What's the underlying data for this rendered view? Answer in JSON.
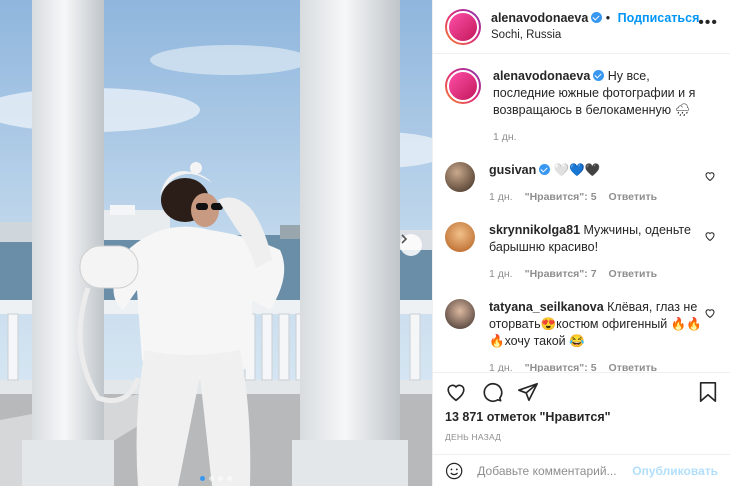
{
  "post": {
    "username": "alenavodonaeva",
    "follow_label": "Подписаться",
    "location": "Sochi, Russia",
    "more_icon": "more-horizontal-icon",
    "colors": {
      "link": "#0095f6",
      "verified": "#3897f0",
      "muted": "#8e8e8e"
    },
    "carousel": {
      "total_slides": 4,
      "active_slide": 1
    },
    "caption": {
      "username": "alenavodonaeva",
      "text": "Ну все, последние южные фотографии и я возвращаюсь в белокаменную 🌧",
      "time": "1 дн."
    },
    "comments": [
      {
        "username": "gusivan",
        "verified": true,
        "text": "🤍💙🖤",
        "time": "1 дн.",
        "likes": "\"Нравится\": 5",
        "reply": "Ответить"
      },
      {
        "username": "skrynnikolga81",
        "verified": false,
        "text": "Мужчины, оденьте барышню красиво!",
        "time": "1 дн.",
        "likes": "\"Нравится\": 7",
        "reply": "Ответить"
      },
      {
        "username": "tatyana_seilkanova",
        "verified": false,
        "text": "Клёвая, глаз не оторвать😍костюм офигенный 🔥🔥🔥хочу такой 😂",
        "time": "1 дн.",
        "likes": "\"Нравится\": 5",
        "reply": "Ответить"
      }
    ],
    "likes_text": "13 871 отметок \"Нравится\"",
    "date_text": "ДЕНЬ НАЗАД",
    "comment_placeholder": "Добавьте комментарий...",
    "publish_label": "Опубликовать"
  }
}
